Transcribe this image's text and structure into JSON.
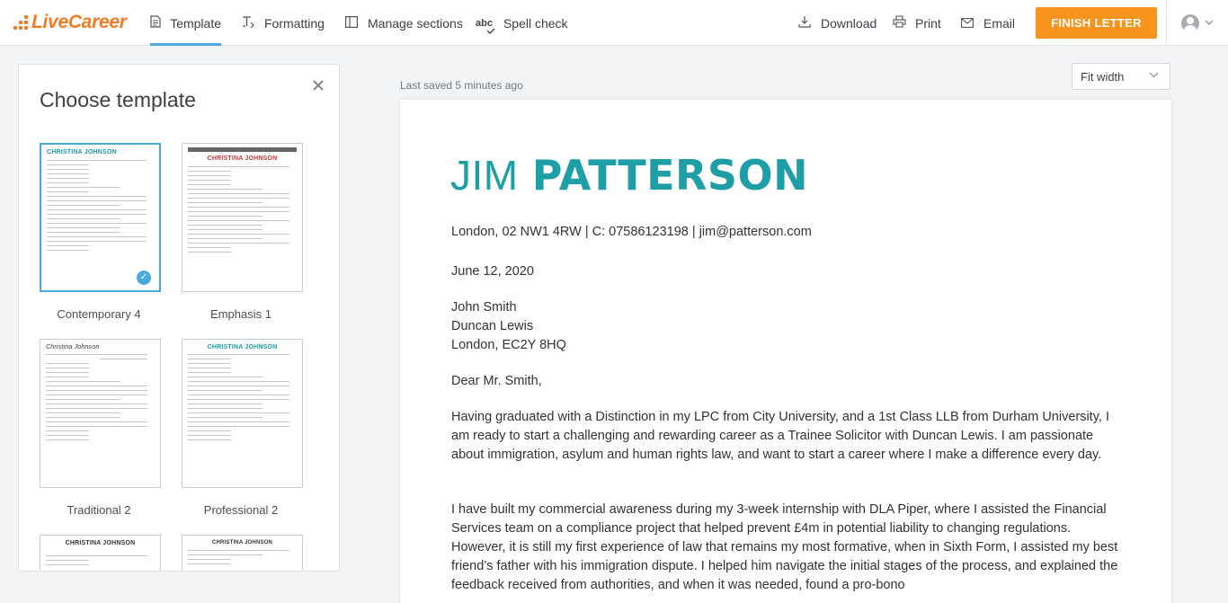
{
  "brand": {
    "name": "LiveCareer",
    "color": "#f47b20"
  },
  "nav": {
    "template": "Template",
    "formatting": "Formatting",
    "manage_sections": "Manage sections",
    "spell_check_badge": "abc",
    "spell_check": "Spell check",
    "download": "Download",
    "print": "Print",
    "email": "Email",
    "finish": "FINISH LETTER"
  },
  "sidebar": {
    "title": "Choose template",
    "templates": [
      {
        "label": "Contemporary 4",
        "selected": true
      },
      {
        "label": "Emphasis 1",
        "selected": false
      },
      {
        "label": "Traditional 2",
        "selected": false
      },
      {
        "label": "Professional 2",
        "selected": false
      }
    ]
  },
  "editor": {
    "last_saved": "Last saved 5 minutes ago",
    "zoom": "Fit width"
  },
  "letter": {
    "first_name": "JIM",
    "last_name": "PATTERSON",
    "contact": "London, 02 NW1 4RW | C: 07586123198 | jim@patterson.com",
    "date": "June 12, 2020",
    "recipient_name": "John Smith",
    "recipient_company": "Duncan Lewis",
    "recipient_address": "London, EC2Y 8HQ",
    "salutation": "Dear Mr. Smith,",
    "paragraph1": "Having graduated with a Distinction in my LPC from City University, and a 1st Class LLB from Durham University, I am ready to start a challenging and rewarding career as a Trainee Solicitor with Duncan Lewis. I am passionate about immigration, asylum and human rights law, and want to start a career where I make a difference every day.",
    "paragraph2": "I have built my commercial awareness during my 3-week internship with DLA Piper, where I assisted the Financial Services team on a compliance project that helped prevent £4m in potential liability to changing regulations. However, it is still my first experience of law that remains my most formative, when in Sixth Form, I assisted my best friend’s father with his immigration dispute. I helped him navigate the initial stages of the process, and explained the feedback received from authorities, and when it was needed, found a pro-bono"
  },
  "colors": {
    "accent": "#1e9ea5",
    "primary_button": "#f7941d",
    "active_tab": "#4aa8dc"
  }
}
